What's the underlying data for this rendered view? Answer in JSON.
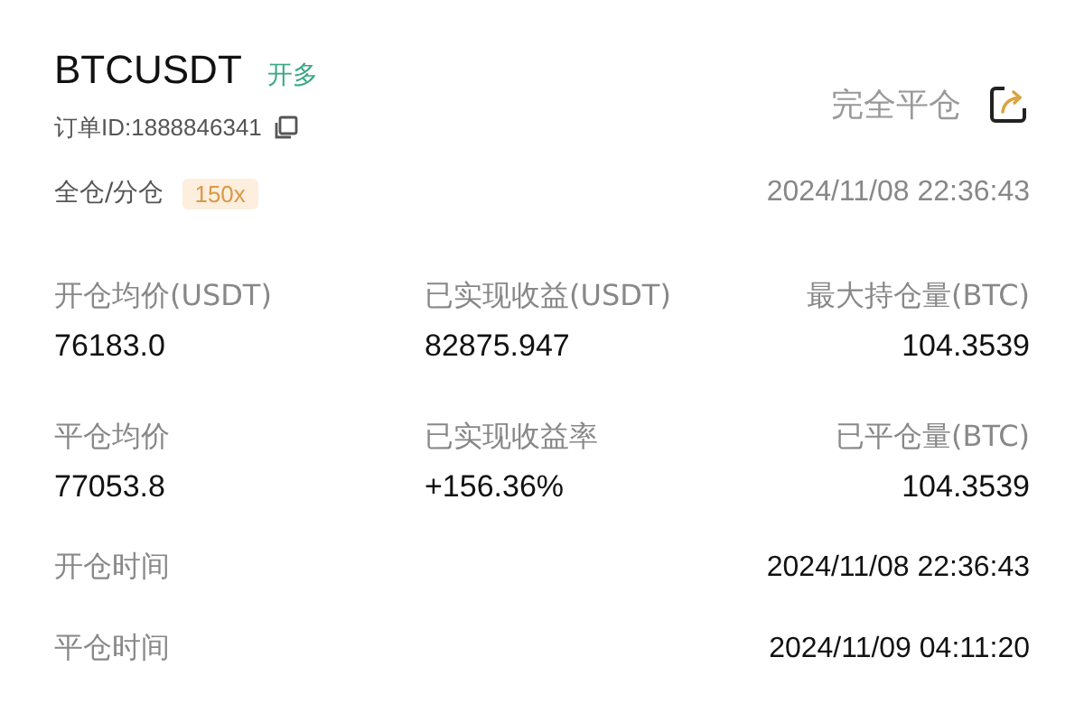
{
  "header": {
    "symbol": "BTCUSDT",
    "side": "开多",
    "order_id": "订单ID:1888846341",
    "close_all": "完全平仓"
  },
  "margin": {
    "mode": "全仓/分仓",
    "leverage": "150x",
    "time": "2024/11/08 22:36:43"
  },
  "stats": [
    {
      "label": "开仓均价(USDT)",
      "value": "76183.0"
    },
    {
      "label": "已实现收益(USDT)",
      "value": "82875.947"
    },
    {
      "label": "最大持仓量(BTC)",
      "value": "104.3539"
    },
    {
      "label": "平仓均价",
      "value": "77053.8"
    },
    {
      "label": "已实现收益率",
      "value": "+156.36%"
    },
    {
      "label": "已平仓量(BTC)",
      "value": "104.3539"
    }
  ],
  "times": [
    {
      "label": "开仓时间",
      "value": "2024/11/08 22:36:43"
    },
    {
      "label": "平仓时间",
      "value": "2024/11/09 04:11:20"
    }
  ]
}
